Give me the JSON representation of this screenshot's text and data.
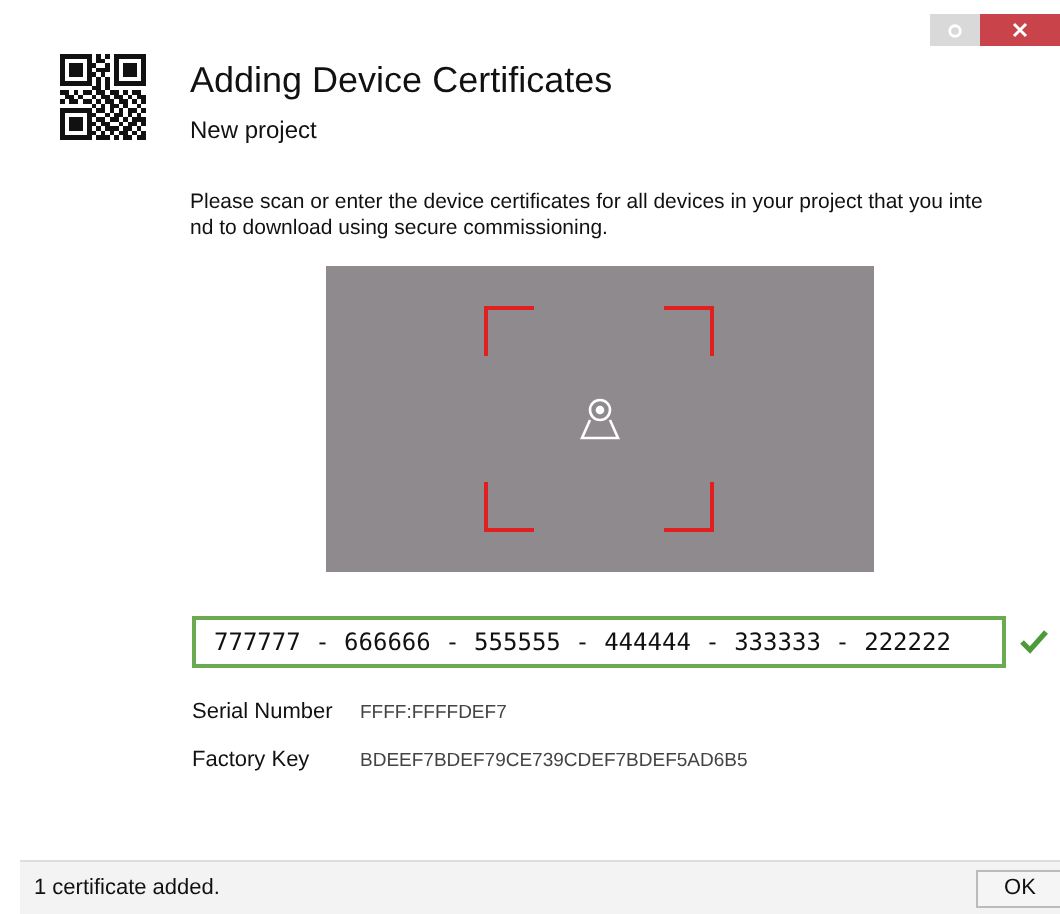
{
  "header": {
    "title": "Adding Device Certificates",
    "subtitle": "New project"
  },
  "instructions": "Please scan or enter the device certificates for all devices in your project that you intend to download using secure commissioning.",
  "certificate_input": {
    "value": "777777 - 666666 - 555555 - 444444 - 333333 - 222222",
    "valid": true
  },
  "details": [
    {
      "label": "Serial Number",
      "value": "FFFF:FFFFDEF7"
    },
    {
      "label": "Factory Key",
      "value": "BDEEF7BDEF79CE739CDEF7BDEF5AD6B5"
    }
  ],
  "status_bar": {
    "message": "1 certificate added.",
    "button": "OK"
  }
}
